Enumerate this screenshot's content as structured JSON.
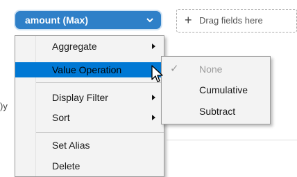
{
  "field_pill": {
    "label": "amount (Max)"
  },
  "drop_zone": {
    "plus": "+",
    "label": "Drag fields here"
  },
  "background_text": ")y",
  "context_menu": {
    "items": [
      {
        "label": "Aggregate",
        "has_submenu": true
      },
      {
        "label": "Value Operation",
        "has_submenu": true,
        "active": true
      },
      {
        "label": "Display Filter",
        "has_submenu": true
      },
      {
        "label": "Sort",
        "has_submenu": true
      },
      {
        "label": "Set Alias",
        "has_submenu": false
      },
      {
        "label": "Delete",
        "has_submenu": false
      }
    ]
  },
  "submenu": {
    "items": [
      {
        "label": "None",
        "checked": true,
        "disabled": true,
        "check_glyph": "✓"
      },
      {
        "label": "Cumulative"
      },
      {
        "label": "Subtract"
      }
    ]
  },
  "colors": {
    "pill": "#2f80c8",
    "highlight": "#0078d4",
    "menu_bg": "#f3f3f3"
  }
}
